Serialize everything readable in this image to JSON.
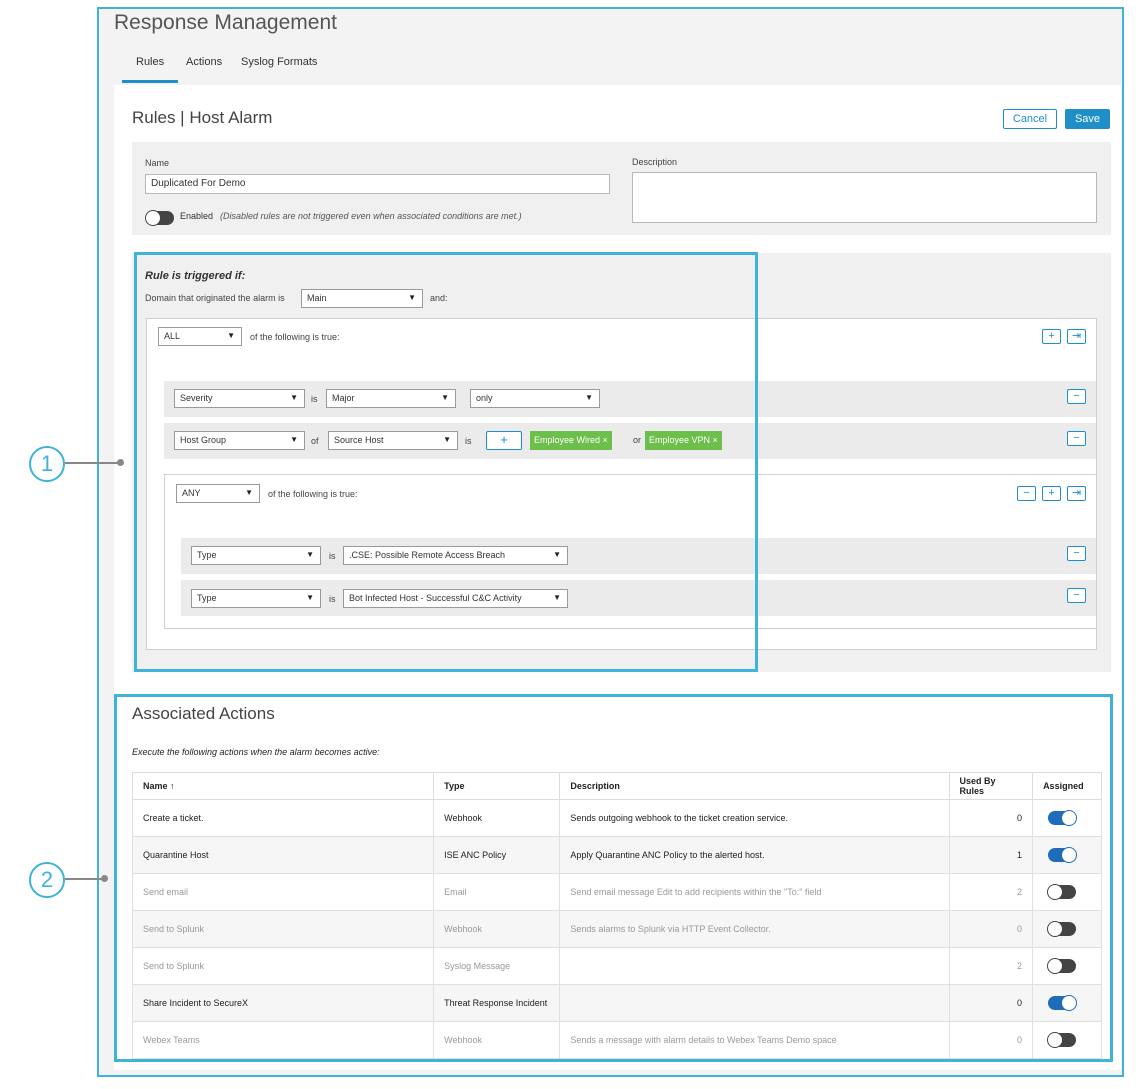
{
  "app_title": "Response Management",
  "tabs": [
    {
      "label": "Rules",
      "active": true
    },
    {
      "label": "Actions",
      "active": false
    },
    {
      "label": "Syslog Formats",
      "active": false
    }
  ],
  "page": {
    "title": "Rules | Host Alarm",
    "cancel_label": "Cancel",
    "save_label": "Save"
  },
  "form": {
    "name_label": "Name",
    "name_value": "Duplicated For Demo",
    "description_label": "Description",
    "description_value": "",
    "enabled_label": "Enabled",
    "enabled_note": "(Disabled rules are not triggered even when associated conditions are met.)",
    "enabled": false
  },
  "rule": {
    "heading": "Rule is triggered if:",
    "domain_prefix": "Domain that originated the alarm is",
    "domain_value": "Main",
    "domain_suffix": "and:",
    "outer_quantifier": "ALL",
    "outer_text": "of the following is true:",
    "severity": {
      "field": "Severity",
      "op": "is",
      "value": "Major",
      "mode": "only"
    },
    "hostgroup": {
      "field": "Host Group",
      "op": "of",
      "source": "Source Host",
      "op2": "is",
      "add_symbol": "+",
      "tags": [
        "Employee Wired",
        "Employee VPN"
      ],
      "tag_remove": "×",
      "joiner": "or"
    },
    "inner_quantifier": "ANY",
    "inner_text": "of the following is true:",
    "inner_rows": [
      {
        "field": "Type",
        "op": "is",
        "value": ".CSE: Possible Remote Access Breach"
      },
      {
        "field": "Type",
        "op": "is",
        "value": "Bot Infected Host - Successful C&C Activity"
      }
    ],
    "btn_plus": "+",
    "btn_minus": "−",
    "btn_indent": "⇥"
  },
  "callouts": [
    "1",
    "2"
  ],
  "actions": {
    "title": "Associated Actions",
    "instruction": "Execute the following actions when the alarm becomes active:",
    "columns": [
      "Name ↑",
      "Type",
      "Description",
      "Used By Rules",
      "Assigned"
    ],
    "rows": [
      {
        "name": "Create a ticket.",
        "type": "Webhook",
        "description": "Sends outgoing webhook to the ticket creation service.",
        "used": "0",
        "assigned": true
      },
      {
        "name": "Quarantine Host",
        "type": "ISE ANC Policy",
        "description": "Apply Quarantine ANC Policy to the alerted host.",
        "used": "1",
        "assigned": true
      },
      {
        "name": "Send email",
        "type": "Email",
        "description": "Send email message Edit to add recipients within the \"To:\" field",
        "used": "2",
        "assigned": false
      },
      {
        "name": "Send to Splunk",
        "type": "Webhook",
        "description": "Sends alarms to Splunk via HTTP Event Collector.",
        "used": "0",
        "assigned": false
      },
      {
        "name": "Send to Splunk",
        "type": "Syslog Message",
        "description": "",
        "used": "2",
        "assigned": false
      },
      {
        "name": "Share Incident to SecureX",
        "type": "Threat Response Incident",
        "description": "",
        "used": "0",
        "assigned": true
      },
      {
        "name": "Webex Teams",
        "type": "Webhook",
        "description": "Sends a message with alarm details to Webex Teams Demo space",
        "used": "0",
        "assigned": false
      }
    ]
  },
  "colors": {
    "accent": "#1f8fc9",
    "callout": "#3fb3d9",
    "tag": "#6cbf4a"
  }
}
